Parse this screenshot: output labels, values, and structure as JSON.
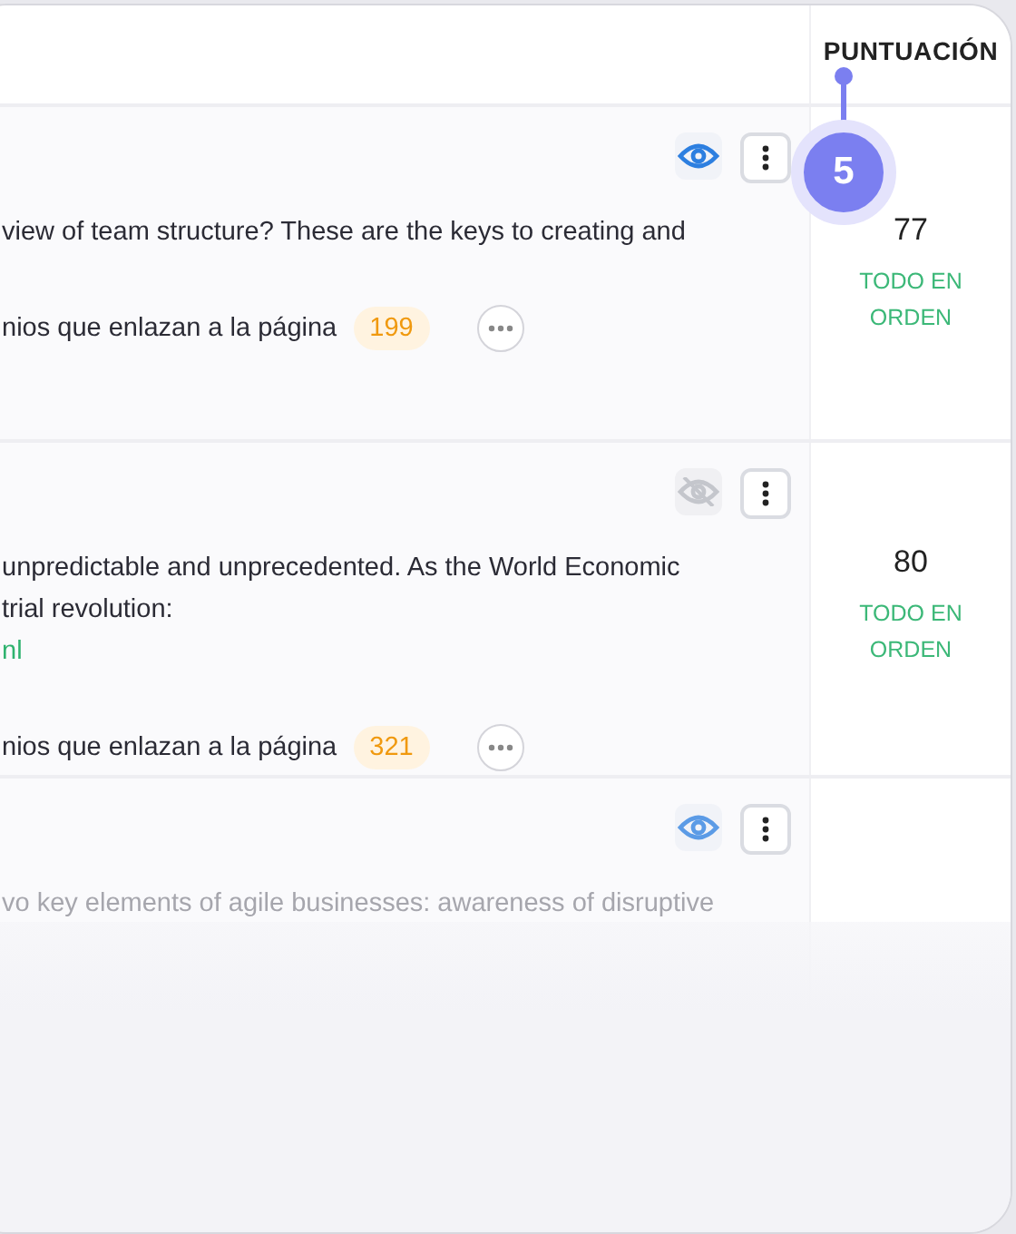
{
  "score_header": "PUNTUACIÓN",
  "step_badge": "5",
  "rows": [
    {
      "visible": true,
      "faded": false,
      "lines": [
        "view of team structure? These are the keys to creating and"
      ],
      "link": "",
      "links_label": "nios que enlazan a la página",
      "links_count": "199",
      "score": "77",
      "status": "TODO EN ORDEN"
    },
    {
      "visible": false,
      "faded": false,
      "lines": [
        "unpredictable and unprecedented. As the World Economic",
        "trial revolution:"
      ],
      "link": "nl",
      "links_label": "nios que enlazan a la página",
      "links_count": "321",
      "score": "80",
      "status": "TODO EN ORDEN"
    },
    {
      "visible": true,
      "faded": true,
      "lines": [
        "vo key elements of agile businesses: awareness of disruptive"
      ],
      "link": "",
      "links_label": "",
      "links_count": "",
      "score": "",
      "status": ""
    }
  ]
}
